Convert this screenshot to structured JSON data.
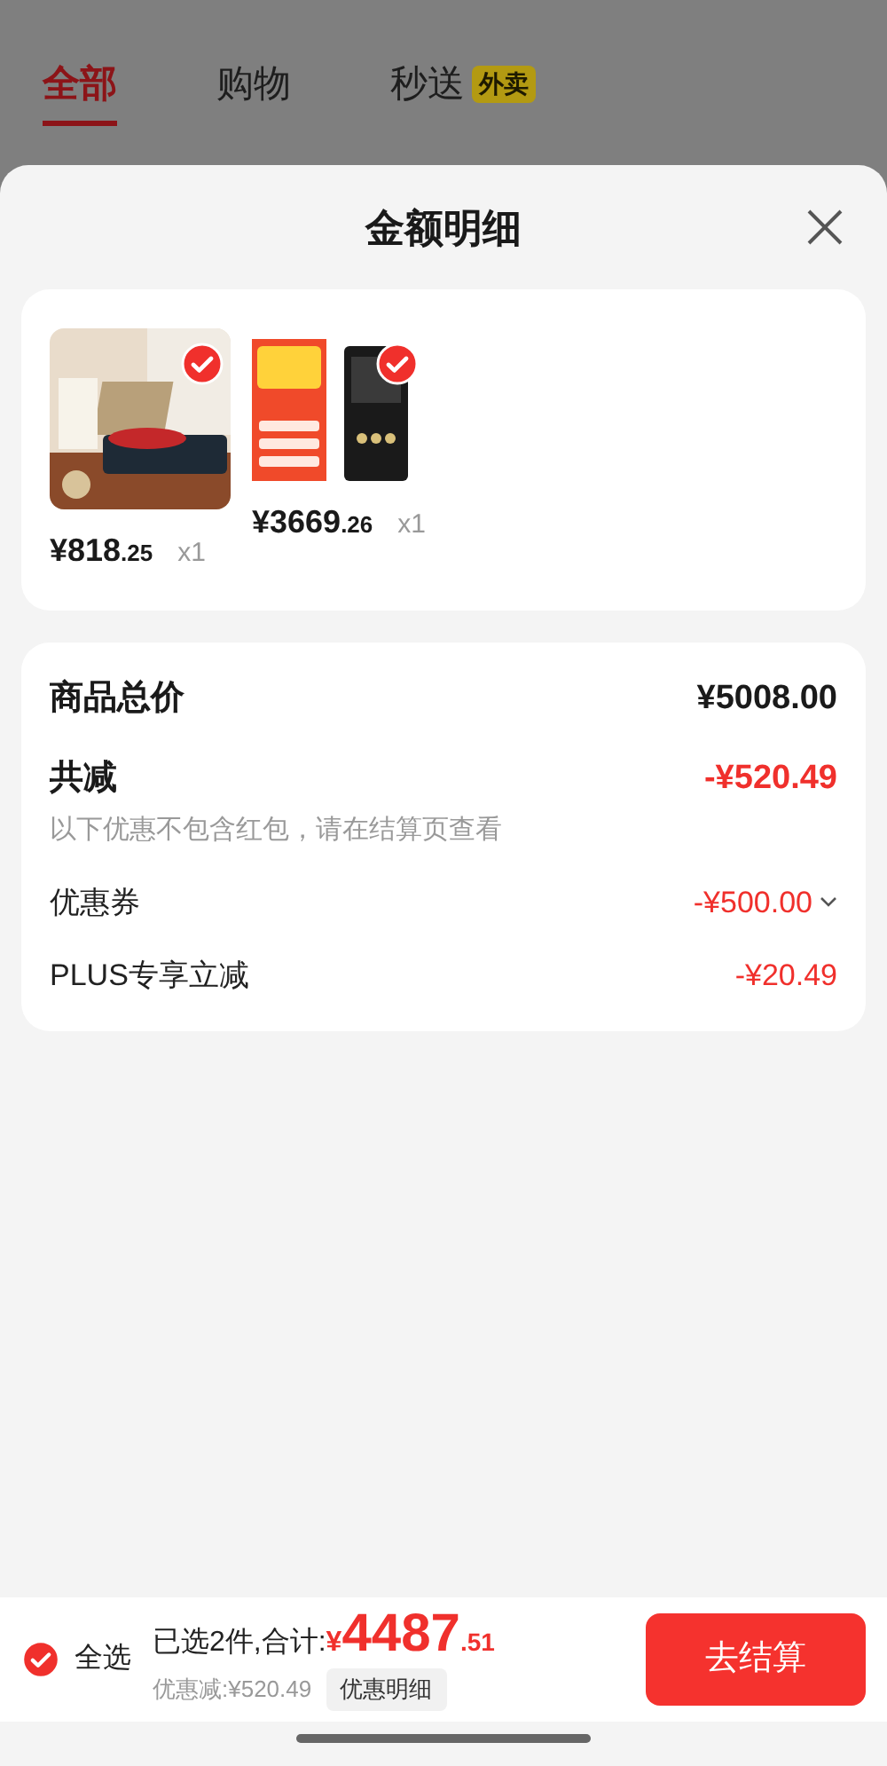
{
  "tabs": [
    {
      "label": "全部",
      "selected": true
    },
    {
      "label": "购物",
      "selected": false
    },
    {
      "label": "秒送",
      "selected": false,
      "badge": "外卖"
    }
  ],
  "sheet": {
    "title": "金额明细"
  },
  "products": [
    {
      "selected": true,
      "price_main": "¥818",
      "price_decimal": ".25",
      "quantity": "x1"
    },
    {
      "selected": true,
      "price_main": "¥3669",
      "price_decimal": ".26",
      "quantity": "x1"
    }
  ],
  "summary": [
    {
      "kind": "total",
      "label": "商品总价",
      "value": "¥5008.00"
    },
    {
      "kind": "reduction",
      "label": "共减",
      "value": "-¥520.49",
      "note": "以下优惠不包含红包，请在结算页查看"
    },
    {
      "kind": "expandable",
      "label": "优惠券",
      "value": "-¥500.00",
      "expanded": false
    },
    {
      "kind": "discount",
      "label": "PLUS专享立减",
      "value": "-¥20.49"
    }
  ],
  "bottom_bar": {
    "select_all": {
      "label": "全选",
      "checked": true
    },
    "selected_count": "已选2件,合计:",
    "currency": "¥",
    "total_main": "4487",
    "total_decimal": ".51",
    "discount": "优惠减:¥520.49",
    "detail_button": "优惠明细",
    "checkout_button": "去结算"
  }
}
